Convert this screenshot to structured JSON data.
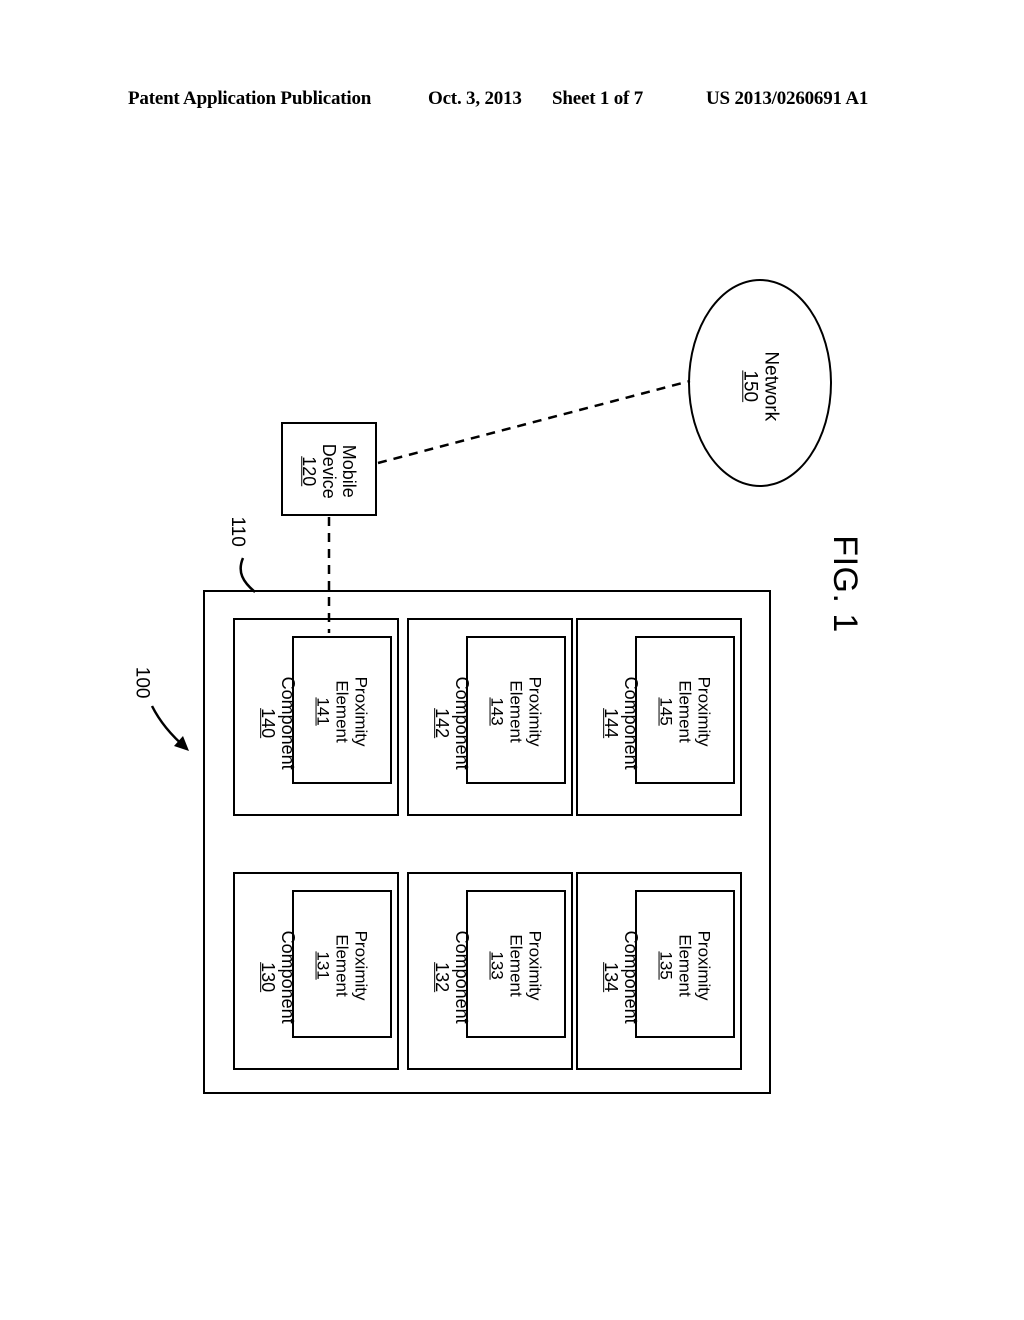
{
  "header": {
    "title": "Patent Application Publication",
    "date": "Oct. 3, 2013",
    "sheet": "Sheet 1 of 7",
    "publication_number": "US 2013/0260691 A1"
  },
  "figure": {
    "label": "FIG. 1",
    "system_reference": "100",
    "apparatus_reference": "110"
  },
  "network": {
    "name": "Network",
    "reference": "150"
  },
  "mobile_device": {
    "name_line1": "Mobile",
    "name_line2": "Device",
    "reference": "120"
  },
  "components": [
    {
      "name": "Component",
      "reference": "140",
      "proximity": {
        "name_line1": "Proximity",
        "name_line2": "Element",
        "reference": "141"
      }
    },
    {
      "name": "Component",
      "reference": "142",
      "proximity": {
        "name_line1": "Proximity",
        "name_line2": "Element",
        "reference": "143"
      }
    },
    {
      "name": "Component",
      "reference": "144",
      "proximity": {
        "name_line1": "Proximity",
        "name_line2": "Element",
        "reference": "145"
      }
    },
    {
      "name": "Component",
      "reference": "130",
      "proximity": {
        "name_line1": "Proximity",
        "name_line2": "Element",
        "reference": "131"
      }
    },
    {
      "name": "Component",
      "reference": "132",
      "proximity": {
        "name_line1": "Proximity",
        "name_line2": "Element",
        "reference": "133"
      }
    },
    {
      "name": "Component",
      "reference": "134",
      "proximity": {
        "name_line1": "Proximity",
        "name_line2": "Element",
        "reference": "135"
      }
    }
  ],
  "connections": [
    {
      "from": "mobile_device",
      "to": "network",
      "style": "dashed"
    },
    {
      "from": "mobile_device",
      "to": "proximity_element_141",
      "style": "dashed"
    }
  ],
  "colors": {
    "ink": "#000000",
    "page": "#ffffff"
  }
}
